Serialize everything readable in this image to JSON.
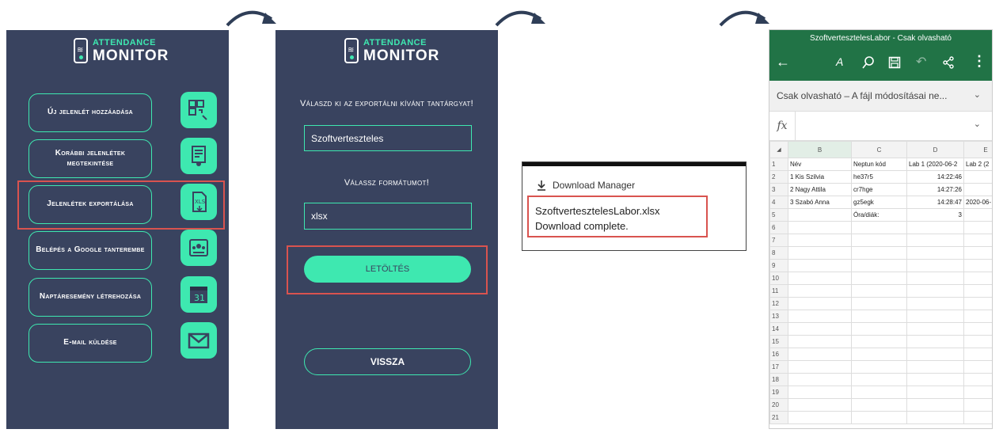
{
  "screen1": {
    "logo_line1": "ATTENDANCE",
    "logo_line2": "MONITOR",
    "menu": [
      {
        "label": "Új jelenlét hozzáadása",
        "icon": "qr-scan-icon"
      },
      {
        "label": "Korábbi jelenlétek megtekintése",
        "icon": "document-view-icon"
      },
      {
        "label": "Jelenlétek exportálása",
        "icon": "xls-export-icon"
      },
      {
        "label": "Belépés a Google tanterembe",
        "icon": "classroom-icon"
      },
      {
        "label": "Naptáresemény létrehozása",
        "icon": "calendar-icon",
        "icon_text": "31"
      },
      {
        "label": "E-mail küldése",
        "icon": "mail-icon"
      }
    ]
  },
  "screen2": {
    "logo_line1": "ATTENDANCE",
    "logo_line2": "MONITOR",
    "subject_prompt": "Válaszd ki az exportálni kívánt tantárgyat!",
    "subject_value": "Szoftverteszteles",
    "format_prompt": "Válassz formátumot!",
    "format_value": "xlsx",
    "download_label": "LETÖLTÉS",
    "back_label": "VISSZA"
  },
  "download": {
    "title": "Download Manager",
    "filename": "SzoftvertesztelesLabor.xlsx",
    "status": "Download complete."
  },
  "spreadsheet": {
    "title": "SzoftvertesztelesLabor - Csak olvasható",
    "readonly_banner": "Csak olvasható – A fájl módosításai ne...",
    "fx_label": "fx",
    "columns": [
      "B",
      "C",
      "D",
      "E"
    ],
    "rows": [
      [
        "1",
        "Név",
        "Neptun kód",
        "Lab 1 (2020-06-2",
        "Lab 2 (2"
      ],
      [
        "2",
        "1 Kis Szilvia",
        "he37r5",
        "14:22:46",
        ""
      ],
      [
        "3",
        "2 Nagy Attila",
        "cr7hge",
        "14:27:26",
        ""
      ],
      [
        "4",
        "3 Szabó Anna",
        "gz5egk",
        "14:28:47",
        "2020-06-"
      ],
      [
        "5",
        "",
        "Óra/diák:",
        "3",
        ""
      ],
      [
        "6",
        "",
        "",
        "",
        ""
      ],
      [
        "7",
        "",
        "",
        "",
        ""
      ],
      [
        "8",
        "",
        "",
        "",
        ""
      ],
      [
        "9",
        "",
        "",
        "",
        ""
      ],
      [
        "10",
        "",
        "",
        "",
        ""
      ],
      [
        "11",
        "",
        "",
        "",
        ""
      ],
      [
        "12",
        "",
        "",
        "",
        ""
      ],
      [
        "13",
        "",
        "",
        "",
        ""
      ],
      [
        "14",
        "",
        "",
        "",
        ""
      ],
      [
        "15",
        "",
        "",
        "",
        ""
      ],
      [
        "16",
        "",
        "",
        "",
        ""
      ],
      [
        "17",
        "",
        "",
        "",
        ""
      ],
      [
        "18",
        "",
        "",
        "",
        ""
      ],
      [
        "19",
        "",
        "",
        "",
        ""
      ],
      [
        "20",
        "",
        "",
        "",
        ""
      ],
      [
        "21",
        "",
        "",
        "",
        ""
      ]
    ]
  },
  "colors": {
    "app_bg": "#39435f",
    "accent": "#3ee8b0",
    "highlight": "#d9534f",
    "excel_green": "#217346"
  }
}
